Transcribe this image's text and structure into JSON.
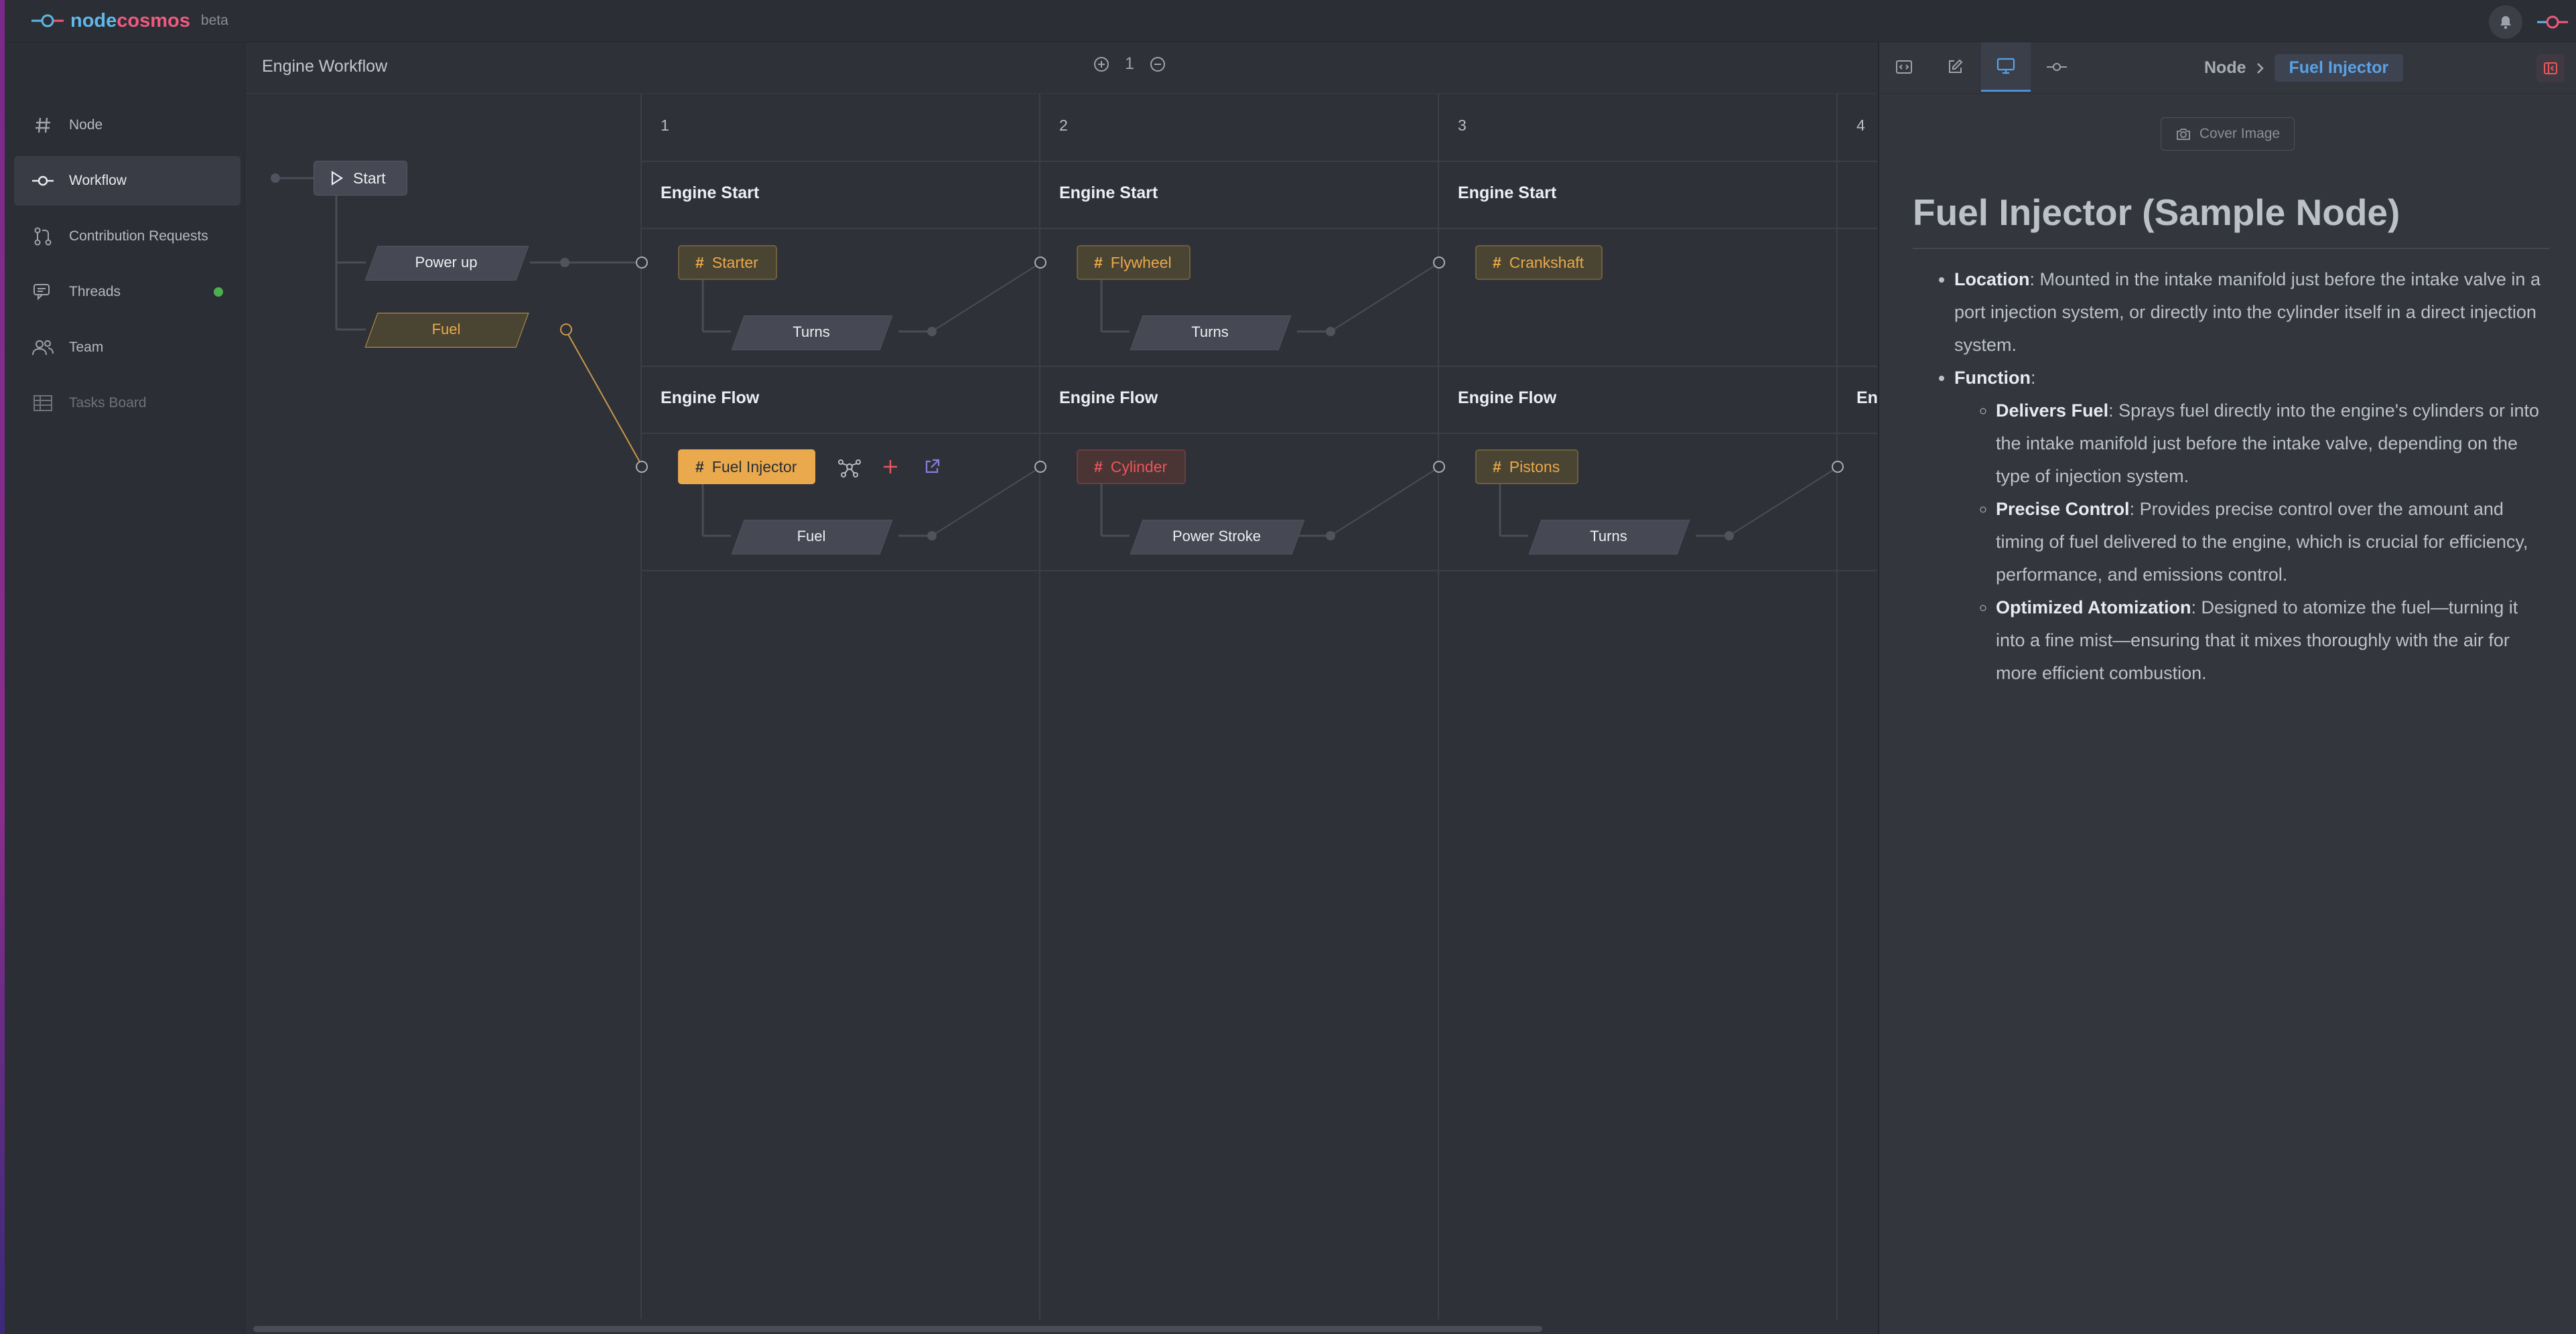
{
  "app": {
    "brand_part1": "node",
    "brand_part2": "cosmos",
    "beta": "beta"
  },
  "sidebar": {
    "items": [
      {
        "label": "Node",
        "icon": "hash-icon"
      },
      {
        "label": "Workflow",
        "icon": "workflow-icon"
      },
      {
        "label": "Contribution Requests",
        "icon": "git-pull-request-icon"
      },
      {
        "label": "Threads",
        "icon": "chat-icon"
      },
      {
        "label": "Team",
        "icon": "team-icon"
      },
      {
        "label": "Tasks Board",
        "icon": "table-icon"
      }
    ]
  },
  "workflow": {
    "title": "Engine Workflow",
    "zoom_level": "1",
    "start_label": "Start",
    "columns": [
      "1",
      "2",
      "3",
      "4"
    ],
    "initial_inputs": [
      "Power up",
      "Fuel"
    ],
    "rows": [
      {
        "steps": [
          {
            "name": "Engine Start",
            "node": "Starter",
            "output": "Turns"
          },
          {
            "name": "Engine Start",
            "node": "Flywheel",
            "output": "Turns"
          },
          {
            "name": "Engine Start",
            "node": "Crankshaft"
          }
        ]
      },
      {
        "steps": [
          {
            "name": "Engine Flow",
            "node": "Fuel Injector",
            "output": "Fuel"
          },
          {
            "name": "Engine Flow",
            "node": "Cylinder",
            "output": "Power Stroke"
          },
          {
            "name": "Engine Flow",
            "node": "Pistons",
            "output": "Turns"
          },
          {
            "name": "En"
          }
        ]
      }
    ]
  },
  "panel": {
    "breadcrumb_root": "Node",
    "breadcrumb_current": "Fuel Injector",
    "cover_image_label": "Cover Image",
    "title": "Fuel Injector (Sample Node)",
    "location_label": "Location",
    "location_text": ": Mounted in the intake manifold just before the intake valve in a port injection system, or directly into the cylinder itself in a direct injection system.",
    "function_label": "Function",
    "function_suffix": ":",
    "function_items": [
      {
        "label": "Delivers Fuel",
        "text": ": Sprays fuel directly into the engine's cylinders or into the intake manifold just before the intake valve, depending on the type of injection system."
      },
      {
        "label": "Precise Control",
        "text": ": Provides precise control over the amount and timing of fuel delivered to the engine, which is crucial for efficiency, performance, and emissions control."
      },
      {
        "label": "Optimized Atomization",
        "text": ": Designed to atomize the fuel—turning it into a fine mist—ensuring that it mixes thoroughly with the air for more efficient combustion."
      }
    ]
  },
  "colors": {
    "accent_blue": "#4a90d9",
    "node_orange": "#e9a94c",
    "node_red": "#e8575d",
    "online_green": "#4caf50"
  }
}
